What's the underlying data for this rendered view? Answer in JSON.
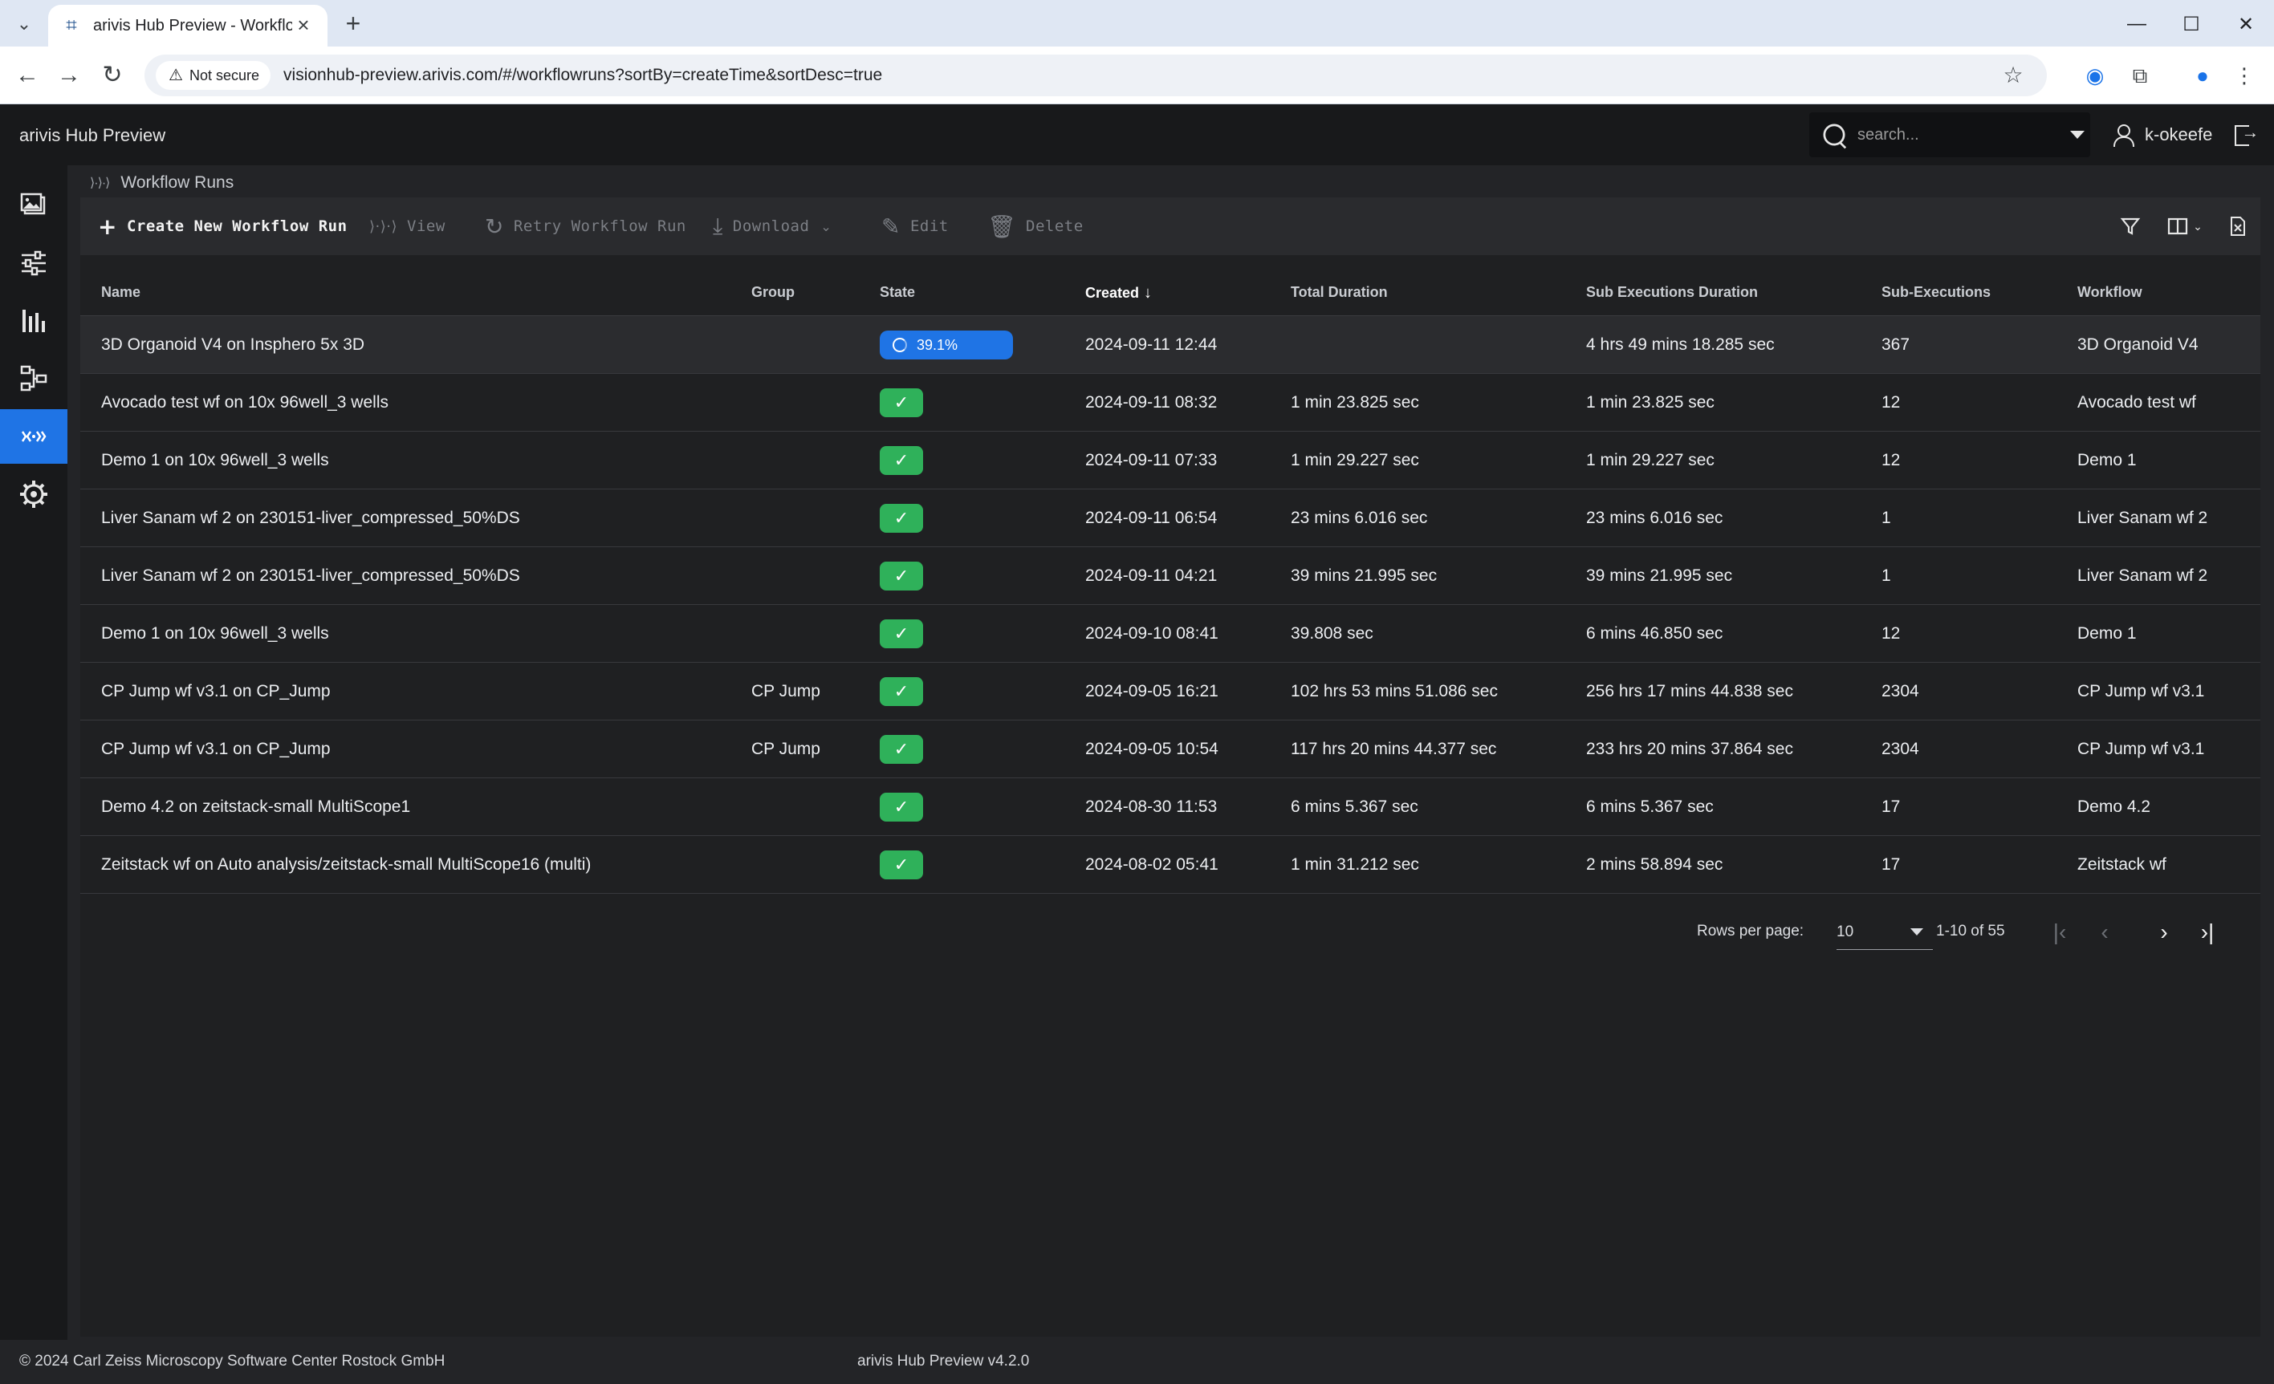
{
  "browser": {
    "tab_title": "arivis Hub Preview - Workflow R",
    "security_label": "Not secure",
    "url": "visionhub-preview.arivis.com/#/workflowruns?sortBy=createTime&sortDesc=true"
  },
  "app": {
    "title": "arivis Hub Preview",
    "search_placeholder": "search...",
    "username": "k-okeefe"
  },
  "sidebar": {
    "items": [
      {
        "icon": "images-icon",
        "active": false
      },
      {
        "icon": "sliders-icon",
        "active": false
      },
      {
        "icon": "bar-chart-icon",
        "active": false
      },
      {
        "icon": "hierarchy-icon",
        "active": false
      },
      {
        "icon": "workflow-runs-icon",
        "active": true
      },
      {
        "icon": "gear-icon",
        "active": false
      }
    ]
  },
  "breadcrumb": {
    "icon": "workflow-runs-icon",
    "label": "Workflow Runs"
  },
  "toolbar": {
    "create": "Create New Workflow Run",
    "view": "View",
    "retry": "Retry Workflow Run",
    "download": "Download",
    "edit": "Edit",
    "delete": "Delete"
  },
  "table": {
    "headers": {
      "name": "Name",
      "group": "Group",
      "state": "State",
      "created": "Created",
      "total_duration": "Total Duration",
      "sub_exec_duration": "Sub Executions Duration",
      "sub_executions": "Sub-Executions",
      "workflow": "Workflow"
    },
    "rows": [
      {
        "name": "3D Organoid V4 on Insphero 5x 3D",
        "group": "",
        "state": "running",
        "progress": "39.1%",
        "created": "2024-09-11 12:44",
        "total_duration": "",
        "sub_exec_duration": "4 hrs 49 mins 18.285 sec",
        "sub_executions": "367",
        "workflow": "3D Organoid V4"
      },
      {
        "name": "Avocado test wf on 10x 96well_3 wells",
        "group": "",
        "state": "done",
        "progress": "",
        "created": "2024-09-11 08:32",
        "total_duration": "1 min 23.825 sec",
        "sub_exec_duration": "1 min 23.825 sec",
        "sub_executions": "12",
        "workflow": "Avocado test wf"
      },
      {
        "name": "Demo 1 on 10x 96well_3 wells",
        "group": "",
        "state": "done",
        "progress": "",
        "created": "2024-09-11 07:33",
        "total_duration": "1 min 29.227 sec",
        "sub_exec_duration": "1 min 29.227 sec",
        "sub_executions": "12",
        "workflow": "Demo 1"
      },
      {
        "name": "Liver Sanam wf 2 on 230151-liver_compressed_50%DS",
        "group": "",
        "state": "done",
        "progress": "",
        "created": "2024-09-11 06:54",
        "total_duration": "23 mins 6.016 sec",
        "sub_exec_duration": "23 mins 6.016 sec",
        "sub_executions": "1",
        "workflow": "Liver Sanam wf 2"
      },
      {
        "name": "Liver Sanam wf 2 on 230151-liver_compressed_50%DS",
        "group": "",
        "state": "done",
        "progress": "",
        "created": "2024-09-11 04:21",
        "total_duration": "39 mins 21.995 sec",
        "sub_exec_duration": "39 mins 21.995 sec",
        "sub_executions": "1",
        "workflow": "Liver Sanam wf 2"
      },
      {
        "name": "Demo 1 on 10x 96well_3 wells",
        "group": "",
        "state": "done",
        "progress": "",
        "created": "2024-09-10 08:41",
        "total_duration": "39.808 sec",
        "sub_exec_duration": "6 mins 46.850 sec",
        "sub_executions": "12",
        "workflow": "Demo 1"
      },
      {
        "name": "CP Jump wf v3.1 on CP_Jump",
        "group": "CP Jump",
        "state": "done",
        "progress": "",
        "created": "2024-09-05 16:21",
        "total_duration": "102 hrs 53 mins 51.086 sec",
        "sub_exec_duration": "256 hrs 17 mins 44.838 sec",
        "sub_executions": "2304",
        "workflow": "CP Jump wf v3.1"
      },
      {
        "name": "CP Jump wf v3.1 on CP_Jump",
        "group": "CP Jump",
        "state": "done",
        "progress": "",
        "created": "2024-09-05 10:54",
        "total_duration": "117 hrs 20 mins 44.377 sec",
        "sub_exec_duration": "233 hrs 20 mins 37.864 sec",
        "sub_executions": "2304",
        "workflow": "CP Jump wf v3.1"
      },
      {
        "name": "Demo 4.2 on zeitstack-small MultiScope1",
        "group": "",
        "state": "done",
        "progress": "",
        "created": "2024-08-30 11:53",
        "total_duration": "6 mins 5.367 sec",
        "sub_exec_duration": "6 mins 5.367 sec",
        "sub_executions": "17",
        "workflow": "Demo 4.2"
      },
      {
        "name": "Zeitstack wf on Auto analysis/zeitstack-small MultiScope16 (multi)",
        "group": "",
        "state": "done",
        "progress": "",
        "created": "2024-08-02 05:41",
        "total_duration": "1 min 31.212 sec",
        "sub_exec_duration": "2 mins 58.894 sec",
        "sub_executions": "17",
        "workflow": "Zeitstack wf"
      }
    ]
  },
  "pagination": {
    "rows_per_page_label": "Rows per page:",
    "rows_per_page": "10",
    "range": "1-10 of 55"
  },
  "footer": {
    "copyright": "© 2024 Carl Zeiss Microscopy Software Center Rostock GmbH",
    "version": "arivis Hub Preview v4.2.0"
  },
  "colors": {
    "accent": "#1f74e5",
    "success": "#2fb15a",
    "background": "#1f2022"
  }
}
